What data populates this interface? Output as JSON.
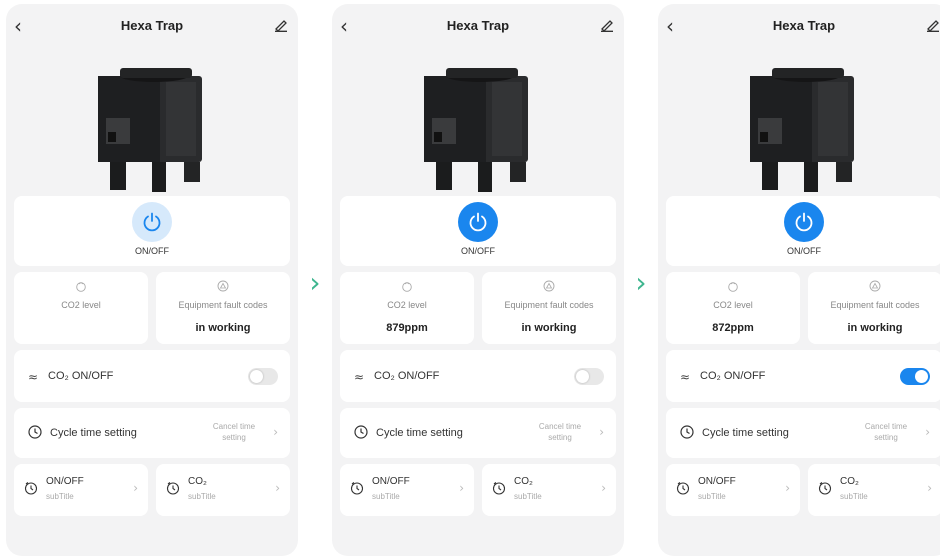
{
  "screens": [
    {
      "title": "Hexa Trap",
      "power_label": "ON/OFF",
      "power_on": false,
      "co2_level_label": "CO2 level",
      "co2_level_value": "",
      "fault_label": "Equipment fault codes",
      "fault_value": "in working",
      "co2_toggle_label": "CO₂ ON/OFF",
      "co2_toggle_on": false,
      "cycle_label": "Cycle time setting",
      "cycle_action": "Cancel time setting",
      "sub1_title": "ON/OFF",
      "sub1_subtitle": "subTitle",
      "sub2_title": "CO₂",
      "sub2_subtitle": "subTitle"
    },
    {
      "title": "Hexa Trap",
      "power_label": "ON/OFF",
      "power_on": true,
      "co2_level_label": "CO2 level",
      "co2_level_value": "879ppm",
      "fault_label": "Equipment fault codes",
      "fault_value": "in working",
      "co2_toggle_label": "CO₂ ON/OFF",
      "co2_toggle_on": false,
      "cycle_label": "Cycle time setting",
      "cycle_action": "Cancel time setting",
      "sub1_title": "ON/OFF",
      "sub1_subtitle": "subTitle",
      "sub2_title": "CO₂",
      "sub2_subtitle": "subTitle"
    },
    {
      "title": "Hexa Trap",
      "power_label": "ON/OFF",
      "power_on": true,
      "co2_level_label": "CO2 level",
      "co2_level_value": "872ppm",
      "fault_label": "Equipment fault codes",
      "fault_value": "in working",
      "co2_toggle_label": "CO₂ ON/OFF",
      "co2_toggle_on": true,
      "cycle_label": "Cycle time setting",
      "cycle_action": "Cancel time setting",
      "sub1_title": "ON/OFF",
      "sub1_subtitle": "subTitle",
      "sub2_title": "CO₂",
      "sub2_subtitle": "subTitle"
    }
  ],
  "separator_icon": "chevron-right-icon",
  "colors": {
    "accent": "#1a86ee",
    "power_off_bg": "#d6e9fb",
    "separator": "#3fb68f",
    "panel_bg": "#f3f3f4"
  }
}
